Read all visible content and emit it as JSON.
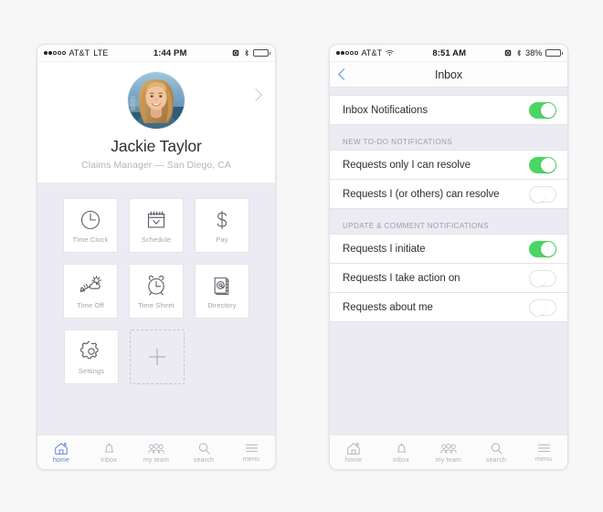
{
  "left_phone": {
    "status_bar": {
      "signal_filled_dots": 2,
      "signal_empty_dots": 3,
      "carrier": "AT&T",
      "network": "LTE",
      "time": "1:44 PM",
      "alarm_icon": "alarm-icon",
      "bluetooth_icon": "bluetooth-icon",
      "battery_percent": "",
      "battery_fill_color": "#2b2b2b",
      "battery_level": 100
    },
    "profile": {
      "avatar_alt": "user-photo",
      "name": "Jackie Taylor",
      "role": "Claims Manager — San Diego, CA",
      "chevron_icon": "chevron-right-icon"
    },
    "app_grid": {
      "rows": [
        [
          {
            "label": "Time Clock",
            "icon": "clock-icon"
          },
          {
            "label": "Schedule",
            "icon": "calendar-icon"
          },
          {
            "label": "Pay",
            "icon": "dollar-icon"
          }
        ],
        [
          {
            "label": "Time Off",
            "icon": "plane-sun-cloud-icon"
          },
          {
            "label": "Time Sheet",
            "icon": "alarm-clock-icon"
          },
          {
            "label": "Directory",
            "icon": "address-book-at-icon"
          }
        ],
        [
          {
            "label": "Settings",
            "icon": "gear-icon"
          },
          {
            "label": "",
            "icon": "plus-icon",
            "type": "add"
          }
        ]
      ]
    },
    "tab_bar": {
      "active_color": "#5b7fc7",
      "items": [
        {
          "label": "home",
          "icon": "home-icon",
          "active": true
        },
        {
          "label": "Inbox",
          "icon": "bell-icon",
          "active": false
        },
        {
          "label": "my team",
          "icon": "people-icon",
          "active": false
        },
        {
          "label": "search",
          "icon": "search-icon",
          "active": false
        },
        {
          "label": "menu",
          "icon": "hamburger-icon",
          "active": false
        }
      ]
    }
  },
  "right_phone": {
    "status_bar": {
      "signal_filled_dots": 2,
      "signal_empty_dots": 3,
      "carrier": "AT&T",
      "network": "wifi-icon",
      "time": "8:51 AM",
      "alarm_icon": "alarm-icon",
      "bluetooth_icon": "bluetooth-icon",
      "battery_percent": "38%",
      "battery_fill_color": "#f6c944",
      "battery_level": 38
    },
    "nav_bar": {
      "back_icon": "chevron-left-icon",
      "title": "Inbox"
    },
    "groups": [
      {
        "header": "",
        "rows": [
          {
            "label": "Inbox Notifications",
            "toggle": "on"
          }
        ]
      },
      {
        "header": "NEW TO-DO NOTIFICATIONS",
        "rows": [
          {
            "label": "Requests only I can resolve",
            "toggle": "on"
          },
          {
            "label": "Requests I (or others) can resolve",
            "toggle": "off"
          }
        ]
      },
      {
        "header": "UPDATE & COMMENT NOTIFICATIONS",
        "rows": [
          {
            "label": "Requests I initiate",
            "toggle": "on"
          },
          {
            "label": "Requests I take action on",
            "toggle": "off"
          },
          {
            "label": "Requests about me",
            "toggle": "off"
          }
        ]
      }
    ],
    "tab_bar": {
      "items": [
        {
          "label": "home",
          "icon": "home-icon",
          "active": false
        },
        {
          "label": "Inbox",
          "icon": "bell-icon",
          "active": false
        },
        {
          "label": "my team",
          "icon": "people-icon",
          "active": false
        },
        {
          "label": "search",
          "icon": "search-icon",
          "active": false
        },
        {
          "label": "menu",
          "icon": "hamburger-icon",
          "active": false
        }
      ]
    }
  },
  "colors": {
    "toggle_on": "#4bd664",
    "accent_blue": "#5b7fc7",
    "nav_blue": "#5b8fdd",
    "panel_bg": "#ecebf3",
    "page_bg": "#f7f7f8"
  }
}
